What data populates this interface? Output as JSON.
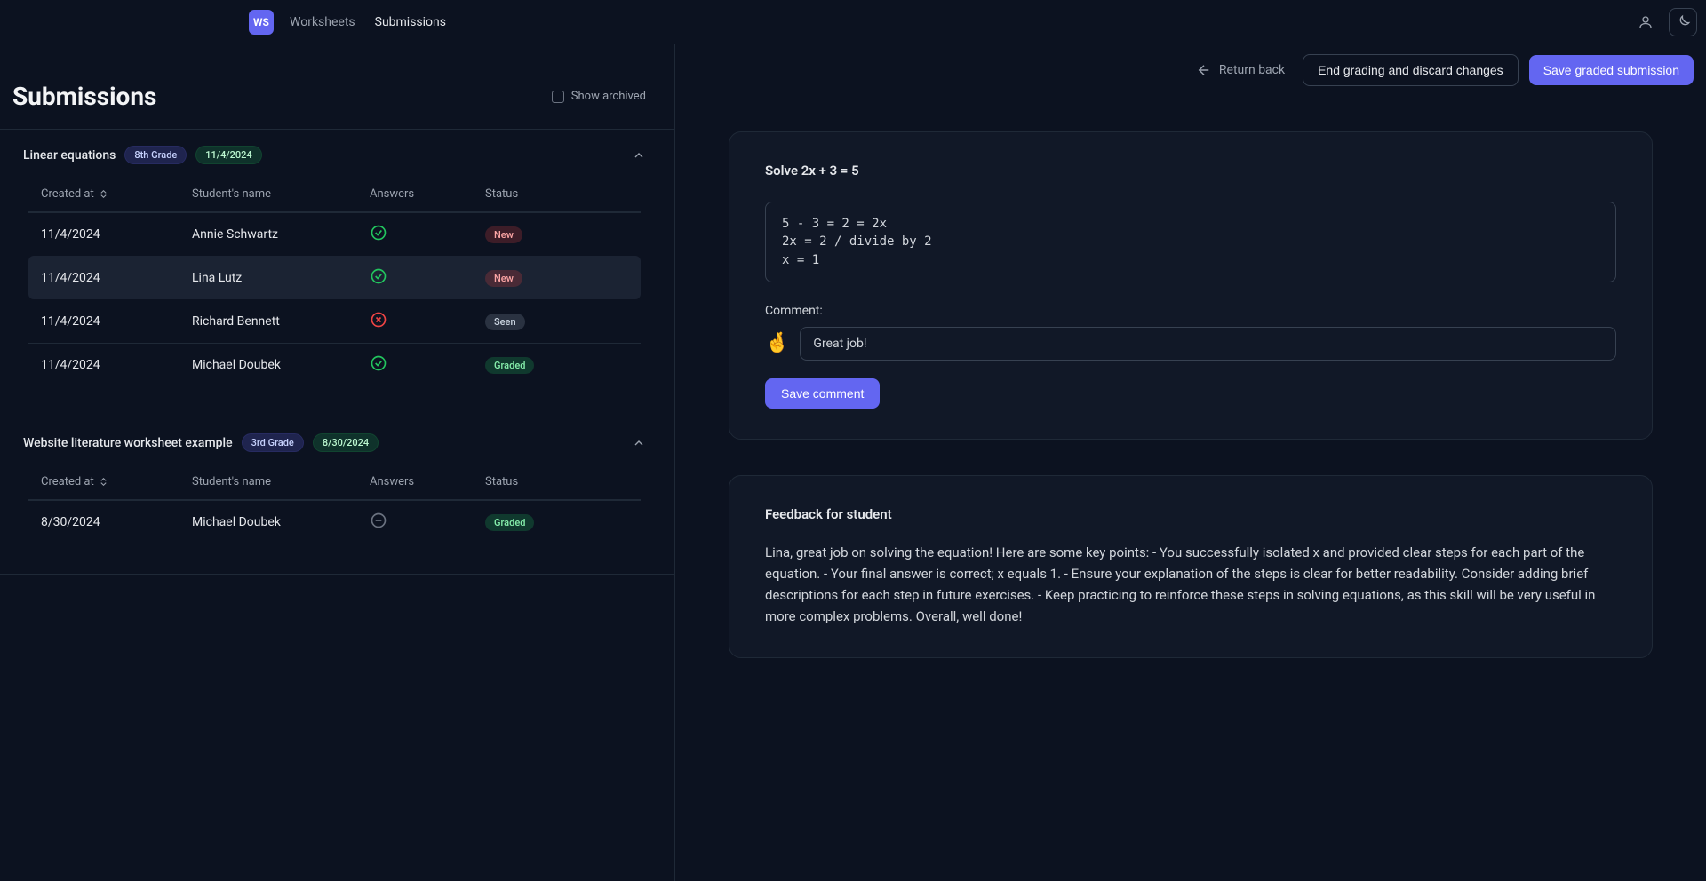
{
  "header": {
    "logo_text": "WS",
    "nav": {
      "worksheets": "Worksheets",
      "submissions": "Submissions"
    }
  },
  "actions": {
    "return_label": "Return back",
    "discard_label": "End grading and discard changes",
    "save_label": "Save graded submission"
  },
  "left": {
    "page_title": "Submissions",
    "show_archived_label": "Show archived",
    "columns": {
      "created_at": "Created at",
      "student_name": "Student's name",
      "answers": "Answers",
      "status": "Status"
    },
    "status_labels": {
      "new": "New",
      "seen": "Seen",
      "graded": "Graded"
    },
    "blocks": [
      {
        "name": "Linear equations",
        "grade": "8th Grade",
        "date": "11/4/2024",
        "rows": [
          {
            "created_at": "11/4/2024",
            "student": "Annie Schwartz",
            "answer": "ok",
            "status": "new"
          },
          {
            "created_at": "11/4/2024",
            "student": "Lina Lutz",
            "answer": "ok",
            "status": "new",
            "selected": true
          },
          {
            "created_at": "11/4/2024",
            "student": "Richard Bennett",
            "answer": "bad",
            "status": "seen"
          },
          {
            "created_at": "11/4/2024",
            "student": "Michael Doubek",
            "answer": "ok",
            "status": "graded"
          }
        ]
      },
      {
        "name": "Website literature worksheet example",
        "grade": "3rd Grade",
        "date": "8/30/2024",
        "rows": [
          {
            "created_at": "8/30/2024",
            "student": "Michael Doubek",
            "answer": "none",
            "status": "graded"
          }
        ]
      }
    ]
  },
  "right": {
    "problem_title": "Solve 2x + 3 = 5",
    "student_answer": "5 - 3 = 2 = 2x\n2x = 2 / divide by 2\nx = 1",
    "comment_label": "Comment:",
    "comment_emoji": "🤞",
    "comment_text": "Great job!",
    "save_comment_label": "Save comment",
    "feedback_title": "Feedback for student",
    "feedback_body": "Lina, great job on solving the equation! Here are some key points: - You successfully isolated x and provided clear steps for each part of the equation. - Your final answer is correct; x equals 1. - Ensure your explanation of the steps is clear for better readability. Consider adding brief descriptions for each step in future exercises. - Keep practicing to reinforce these steps in solving equations, as this skill will be very useful in more complex problems. Overall, well done!"
  }
}
